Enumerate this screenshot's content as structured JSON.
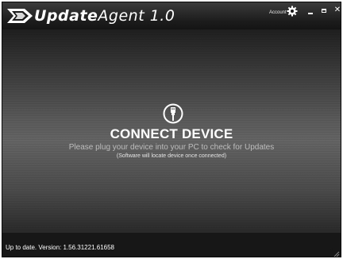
{
  "app": {
    "title_bold": "Update",
    "title_light": "Agent 1.0"
  },
  "titlebar": {
    "account_label": "Account",
    "minimize_label": "minimize",
    "maximize_label": "maximize",
    "close_label": "close",
    "close_glyph": "✕"
  },
  "main": {
    "heading": "CONNECT DEVICE",
    "instruction": "Please plug your device into your PC to check for Updates",
    "note": "(Software will locate device once connected)"
  },
  "status": {
    "text": "Up to date. Version: 1.56.31221.61658"
  },
  "icons": {
    "logo": "arrow-logo-icon",
    "account": "gear-icon",
    "device": "usb-plug-icon",
    "resize": "resize-grip-icon"
  }
}
